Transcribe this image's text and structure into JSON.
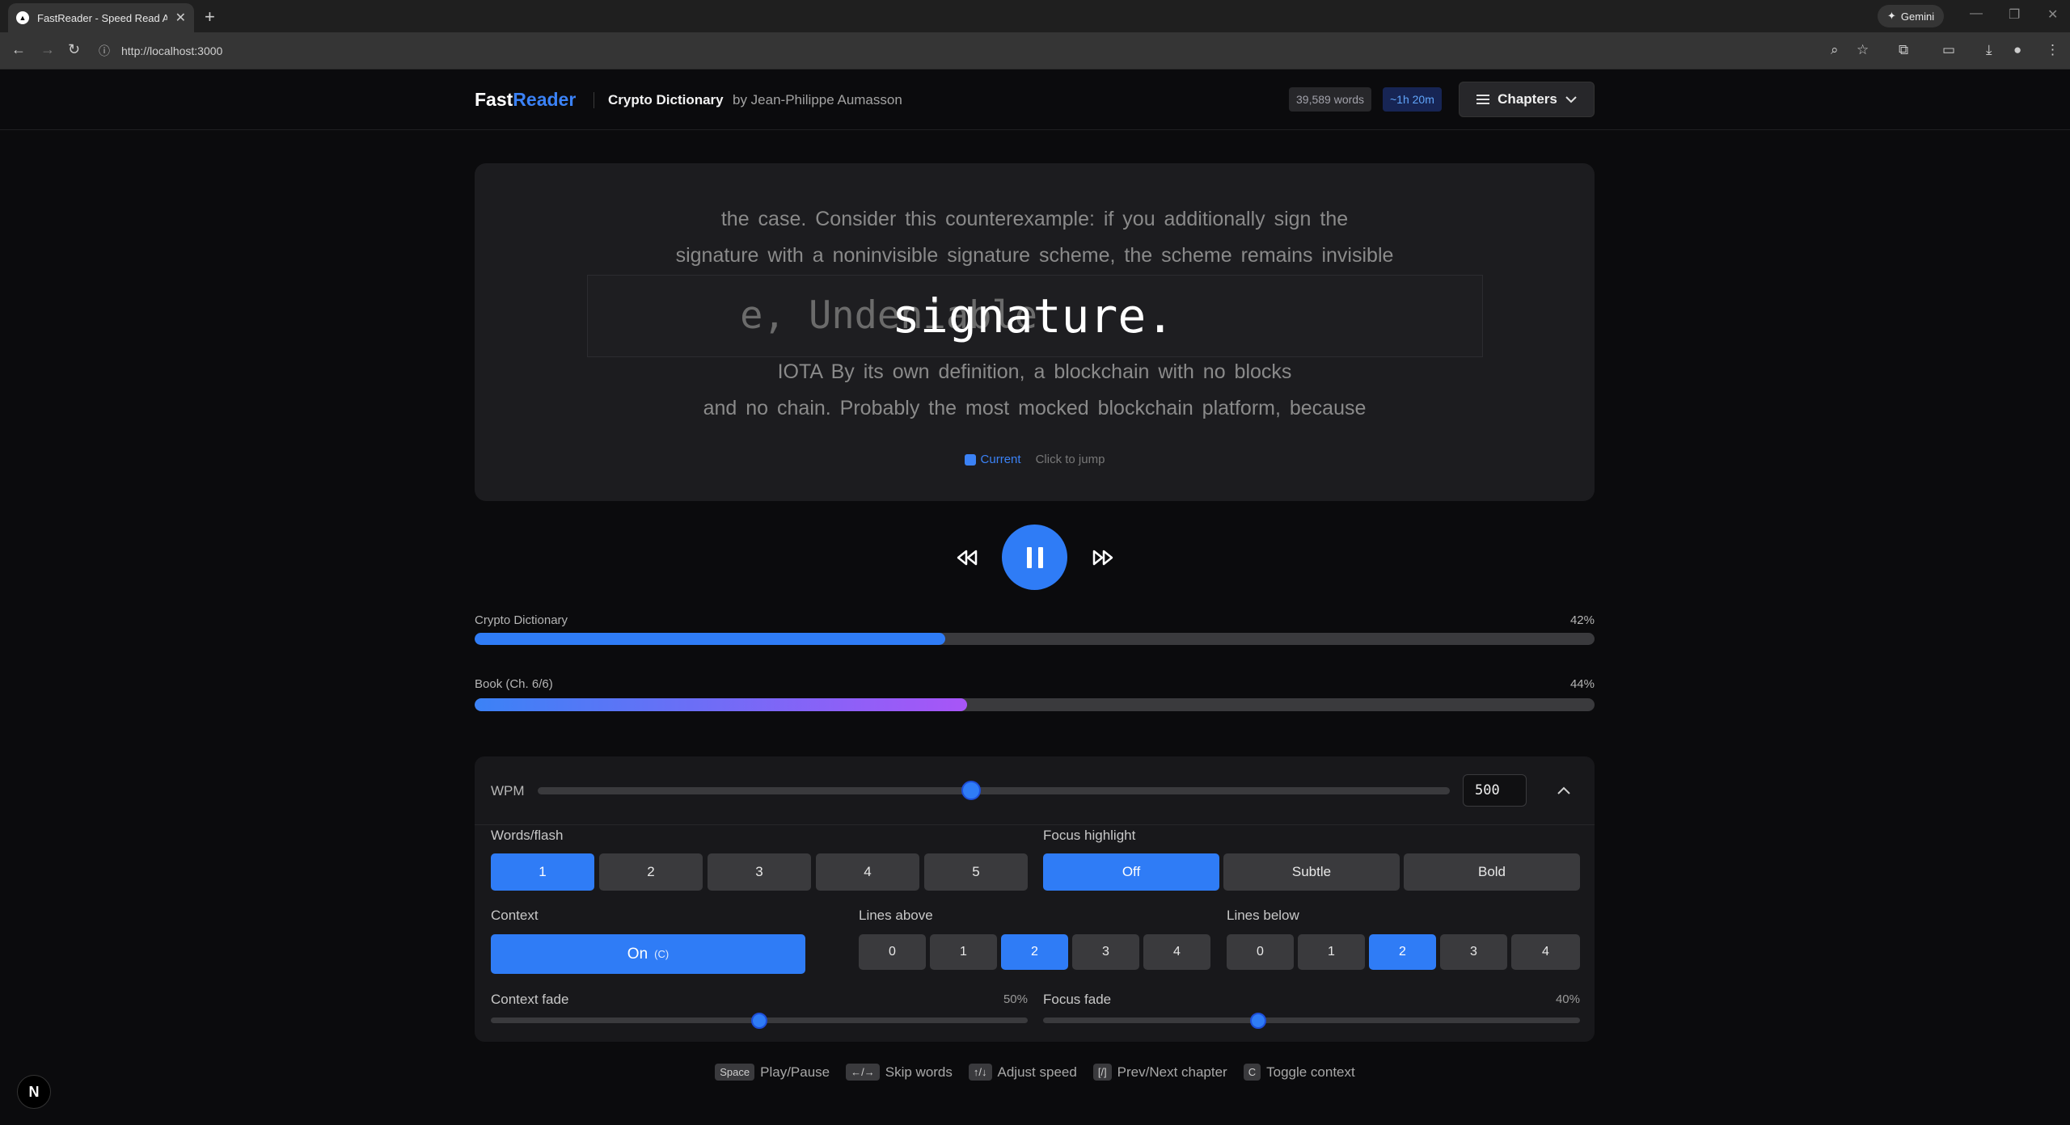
{
  "browser": {
    "tab_title": "FastReader - Speed Read Any Book",
    "tab_close": "✕",
    "new_tab": "+",
    "gemini_label": "Gemini",
    "url": "http://localhost:3000"
  },
  "header": {
    "brand_part1": "Fast",
    "brand_part2": "Reader",
    "book_title": "Crypto Dictionary",
    "byline": "by Jean-Philippe Aumasson",
    "word_count": "39,589 words",
    "time_remaining": "~1h 20m",
    "chapters_label": "Chapters"
  },
  "reader": {
    "lines_above": [
      "the case. Consider this counterexample: if you additionally sign the",
      "signature with a noninvisible signature scheme, the scheme remains invisible"
    ],
    "previous_words": "e, Undeniable",
    "current_word": "signature.",
    "lines_below": [
      "IOTA By its own definition, a blockchain with no blocks",
      "and no chain. Probably the most mocked blockchain platform, because"
    ],
    "legend_current": "Current",
    "legend_jump": "Click to jump"
  },
  "progress": {
    "chapter_label": "Crypto Dictionary",
    "chapter_pct": "42%",
    "chapter_value": 0.42,
    "book_label": "Book (Ch. 6/6)",
    "book_pct": "44%",
    "book_value": 0.44
  },
  "settings": {
    "wpm_label": "WPM",
    "wpm_value": "500",
    "wpm_slider_fraction": 0.475,
    "words_flash_label": "Words/flash",
    "words_flash_options": [
      "1",
      "2",
      "3",
      "4",
      "5"
    ],
    "words_flash_selected": "1",
    "focus_highlight_label": "Focus highlight",
    "focus_highlight_options": [
      "Off",
      "Subtle",
      "Bold"
    ],
    "focus_highlight_selected": "Off",
    "context_label": "Context",
    "context_value": "On",
    "context_key": "(C)",
    "lines_above_label": "Lines above",
    "lines_above_options": [
      "0",
      "1",
      "2",
      "3",
      "4"
    ],
    "lines_above_selected": "2",
    "lines_below_label": "Lines below",
    "lines_below_options": [
      "0",
      "1",
      "2",
      "3",
      "4"
    ],
    "lines_below_selected": "2",
    "context_fade_label": "Context fade",
    "context_fade_pct": "50%",
    "context_fade_value": 0.5,
    "focus_fade_label": "Focus fade",
    "focus_fade_pct": "40%",
    "focus_fade_value": 0.4
  },
  "shortcuts": [
    {
      "key": "Space",
      "label": "Play/Pause"
    },
    {
      "key": "←/→",
      "label": "Skip words"
    },
    {
      "key": "↑/↓",
      "label": "Adjust speed"
    },
    {
      "key": "[/]",
      "label": "Prev/Next chapter"
    },
    {
      "key": "C",
      "label": "Toggle context"
    }
  ],
  "dev_badge": "N",
  "colors": {
    "accent": "#2f7cf6",
    "book_gradient_start": "#3b82f6",
    "book_gradient_end": "#a855f7"
  }
}
